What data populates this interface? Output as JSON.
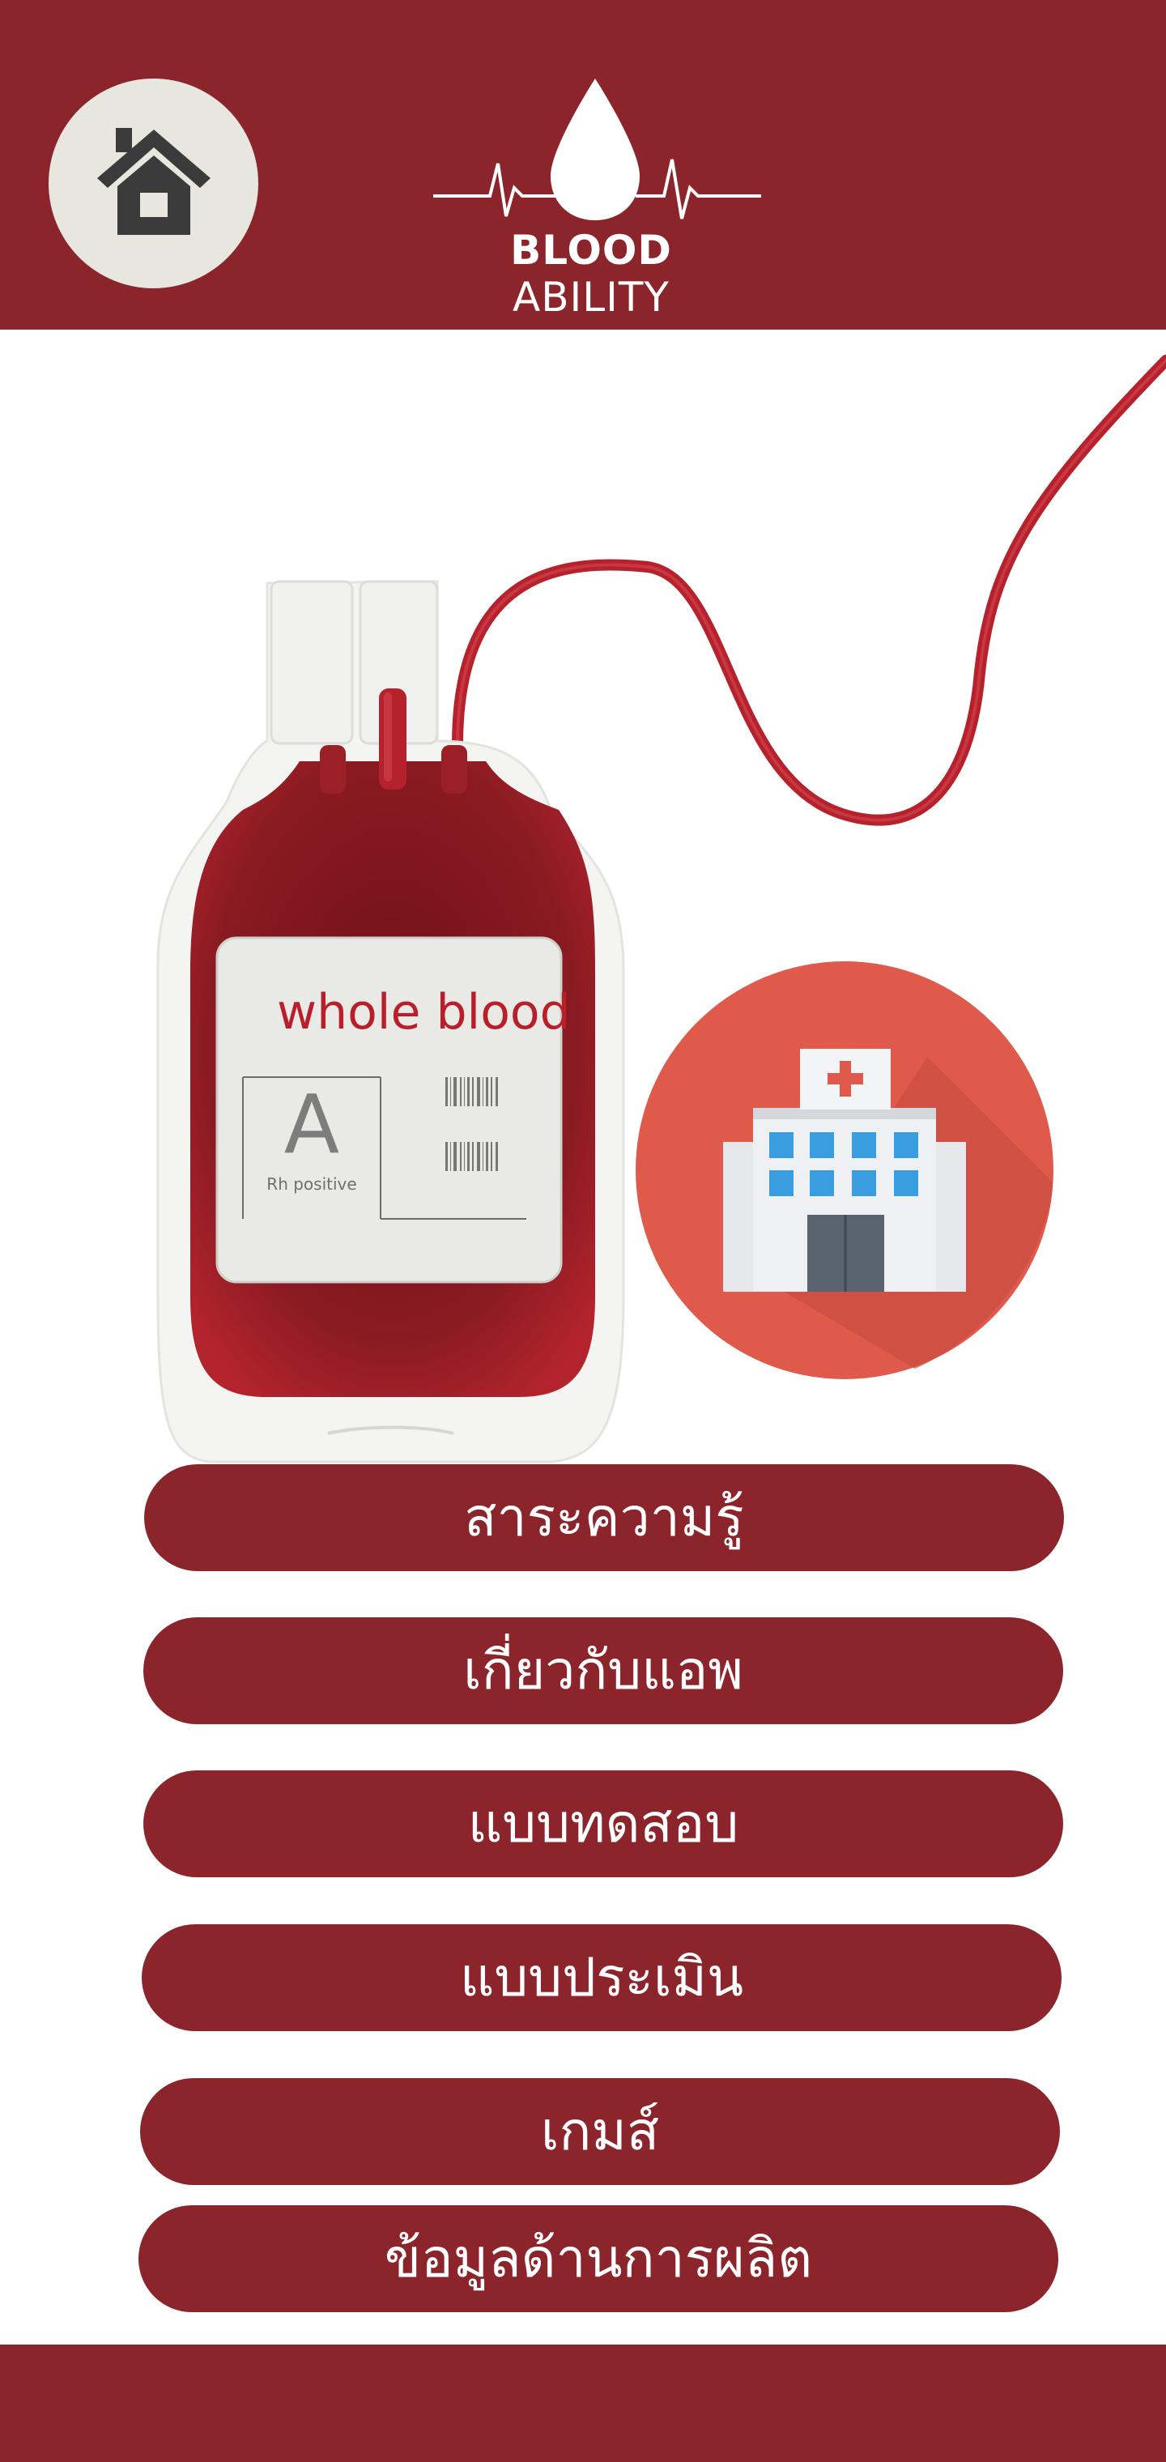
{
  "header": {
    "home_icon": "home-icon",
    "logo_bold": "BLOOD",
    "logo_light": " ABILITY"
  },
  "illustration": {
    "bag_title": "whole blood",
    "blood_type": "A",
    "rh": "Rh positive",
    "hospital_icon": "hospital-icon"
  },
  "menu": {
    "items": [
      {
        "label": "สาระความรู้"
      },
      {
        "label": "เกี่ยวกับแอพ"
      },
      {
        "label": "แบบทดสอบ"
      },
      {
        "label": "แบบประเมิน"
      },
      {
        "label": "เกมส์"
      },
      {
        "label": "ข้อมูลด้านการผลิต"
      }
    ]
  },
  "colors": {
    "primary": "#8c252b",
    "home_bg": "#e7e6df",
    "hospital_circle": "#e05a4c"
  }
}
